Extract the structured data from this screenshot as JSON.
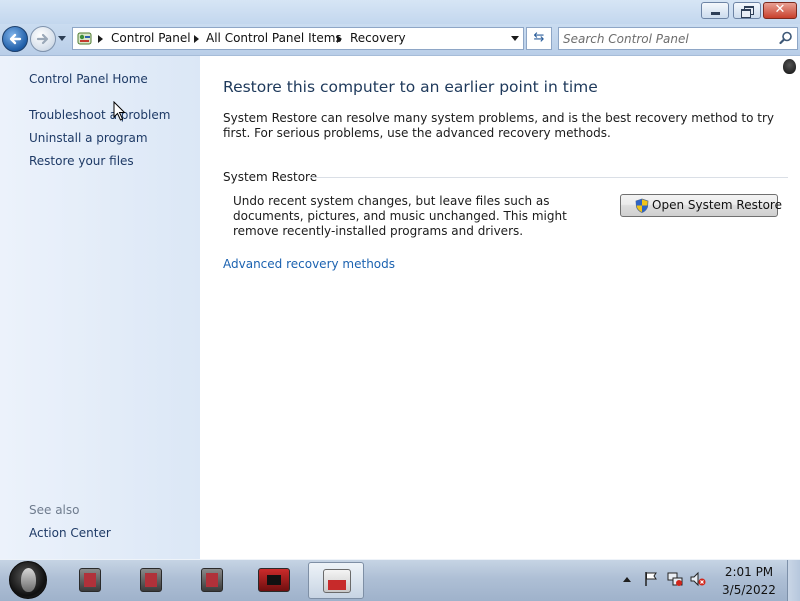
{
  "window": {
    "minimize_icon": "minimize-icon",
    "maximize_icon": "restore-down-icon",
    "close_icon": "close-icon",
    "close_glyph": "✕"
  },
  "nav": {
    "back_icon": "back-arrow-icon",
    "forward_icon": "forward-arrow-icon",
    "breadcrumbs": [
      "Control Panel",
      "All Control Panel Items",
      "Recovery"
    ],
    "refresh_glyph": "⇆",
    "search_placeholder": "Search Control Panel"
  },
  "sidebar": {
    "home": "Control Panel Home",
    "links": [
      "Troubleshoot a problem",
      "Uninstall a program",
      "Restore your files"
    ],
    "see_also_heading": "See also",
    "see_also_links": [
      "Action Center"
    ]
  },
  "main": {
    "title": "Restore this computer to an earlier point in time",
    "intro": "System Restore can resolve many system problems, and is the best recovery method to try first. For serious problems, use the advanced recovery methods.",
    "section_title": "System Restore",
    "section_desc": "Undo recent system changes, but leave files such as documents, pictures, and music unchanged. This might remove recently-installed programs and drivers.",
    "open_button": "Open System Restore",
    "advanced_link": "Advanced recovery methods"
  },
  "taskbar": {
    "clock_time": "2:01 PM",
    "clock_date": "3/5/2022",
    "tray_icons": [
      "action-center-flag-icon",
      "network-icon",
      "volume-muted-icon"
    ]
  },
  "colors": {
    "link": "#1b62b0",
    "title": "#1e395b",
    "sidebar_bg": "#dbe7f6"
  }
}
